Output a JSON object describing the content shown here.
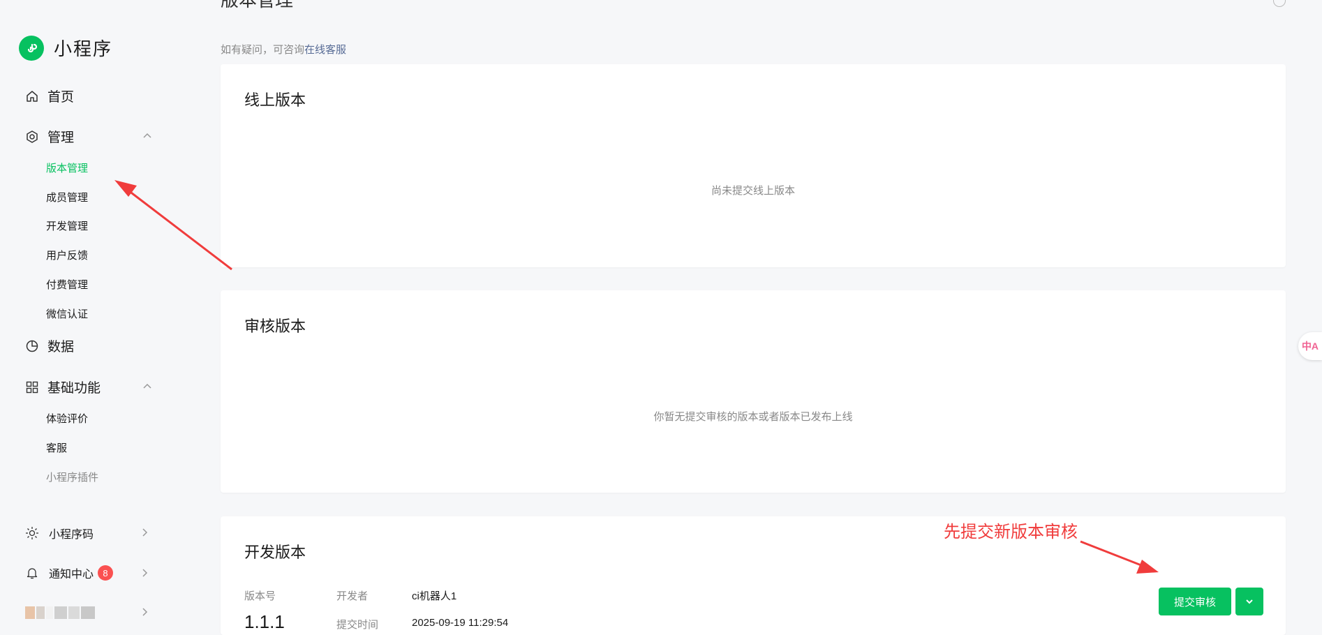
{
  "page": {
    "title": "版本管理"
  },
  "sidebar": {
    "brand": "小程序",
    "items": [
      {
        "label": "首页",
        "icon": "home-icon"
      },
      {
        "label": "管理",
        "icon": "settings-hexagon-icon",
        "expanded": true,
        "children": [
          "版本管理",
          "成员管理",
          "开发管理",
          "用户反馈",
          "付费管理",
          "微信认证"
        ],
        "active_child": "版本管理"
      },
      {
        "label": "数据",
        "icon": "pie-chart-icon"
      },
      {
        "label": "基础功能",
        "icon": "grid-icon",
        "expanded": true,
        "children": [
          "体验评价",
          "客服",
          "小程序插件"
        ]
      }
    ],
    "bottom": [
      {
        "label": "小程序码",
        "icon": "qrcode-sun-icon"
      },
      {
        "label": "通知中心",
        "icon": "bell-icon",
        "badge": "8"
      }
    ]
  },
  "notice": {
    "prefix": "如有疑问，可咨询",
    "link": "在线客服"
  },
  "online_version": {
    "title": "线上版本",
    "empty": "尚未提交线上版本"
  },
  "review_version": {
    "title": "审核版本",
    "empty": "你暂无提交审核的版本或者版本已发布上线"
  },
  "dev_version": {
    "title": "开发版本",
    "version_label": "版本号",
    "version": "1.1.1",
    "developer_label": "开发者",
    "developer": "ci机器人1",
    "submit_time_label": "提交时间",
    "submit_time": "2025-09-19 11:29:54",
    "submit_button": "提交审核"
  },
  "annotation": {
    "text": "先提交新版本审核",
    "color": "#f03c3c"
  },
  "colors": {
    "accent": "#07c160",
    "badge": "#fa5151",
    "link": "#576b95"
  }
}
